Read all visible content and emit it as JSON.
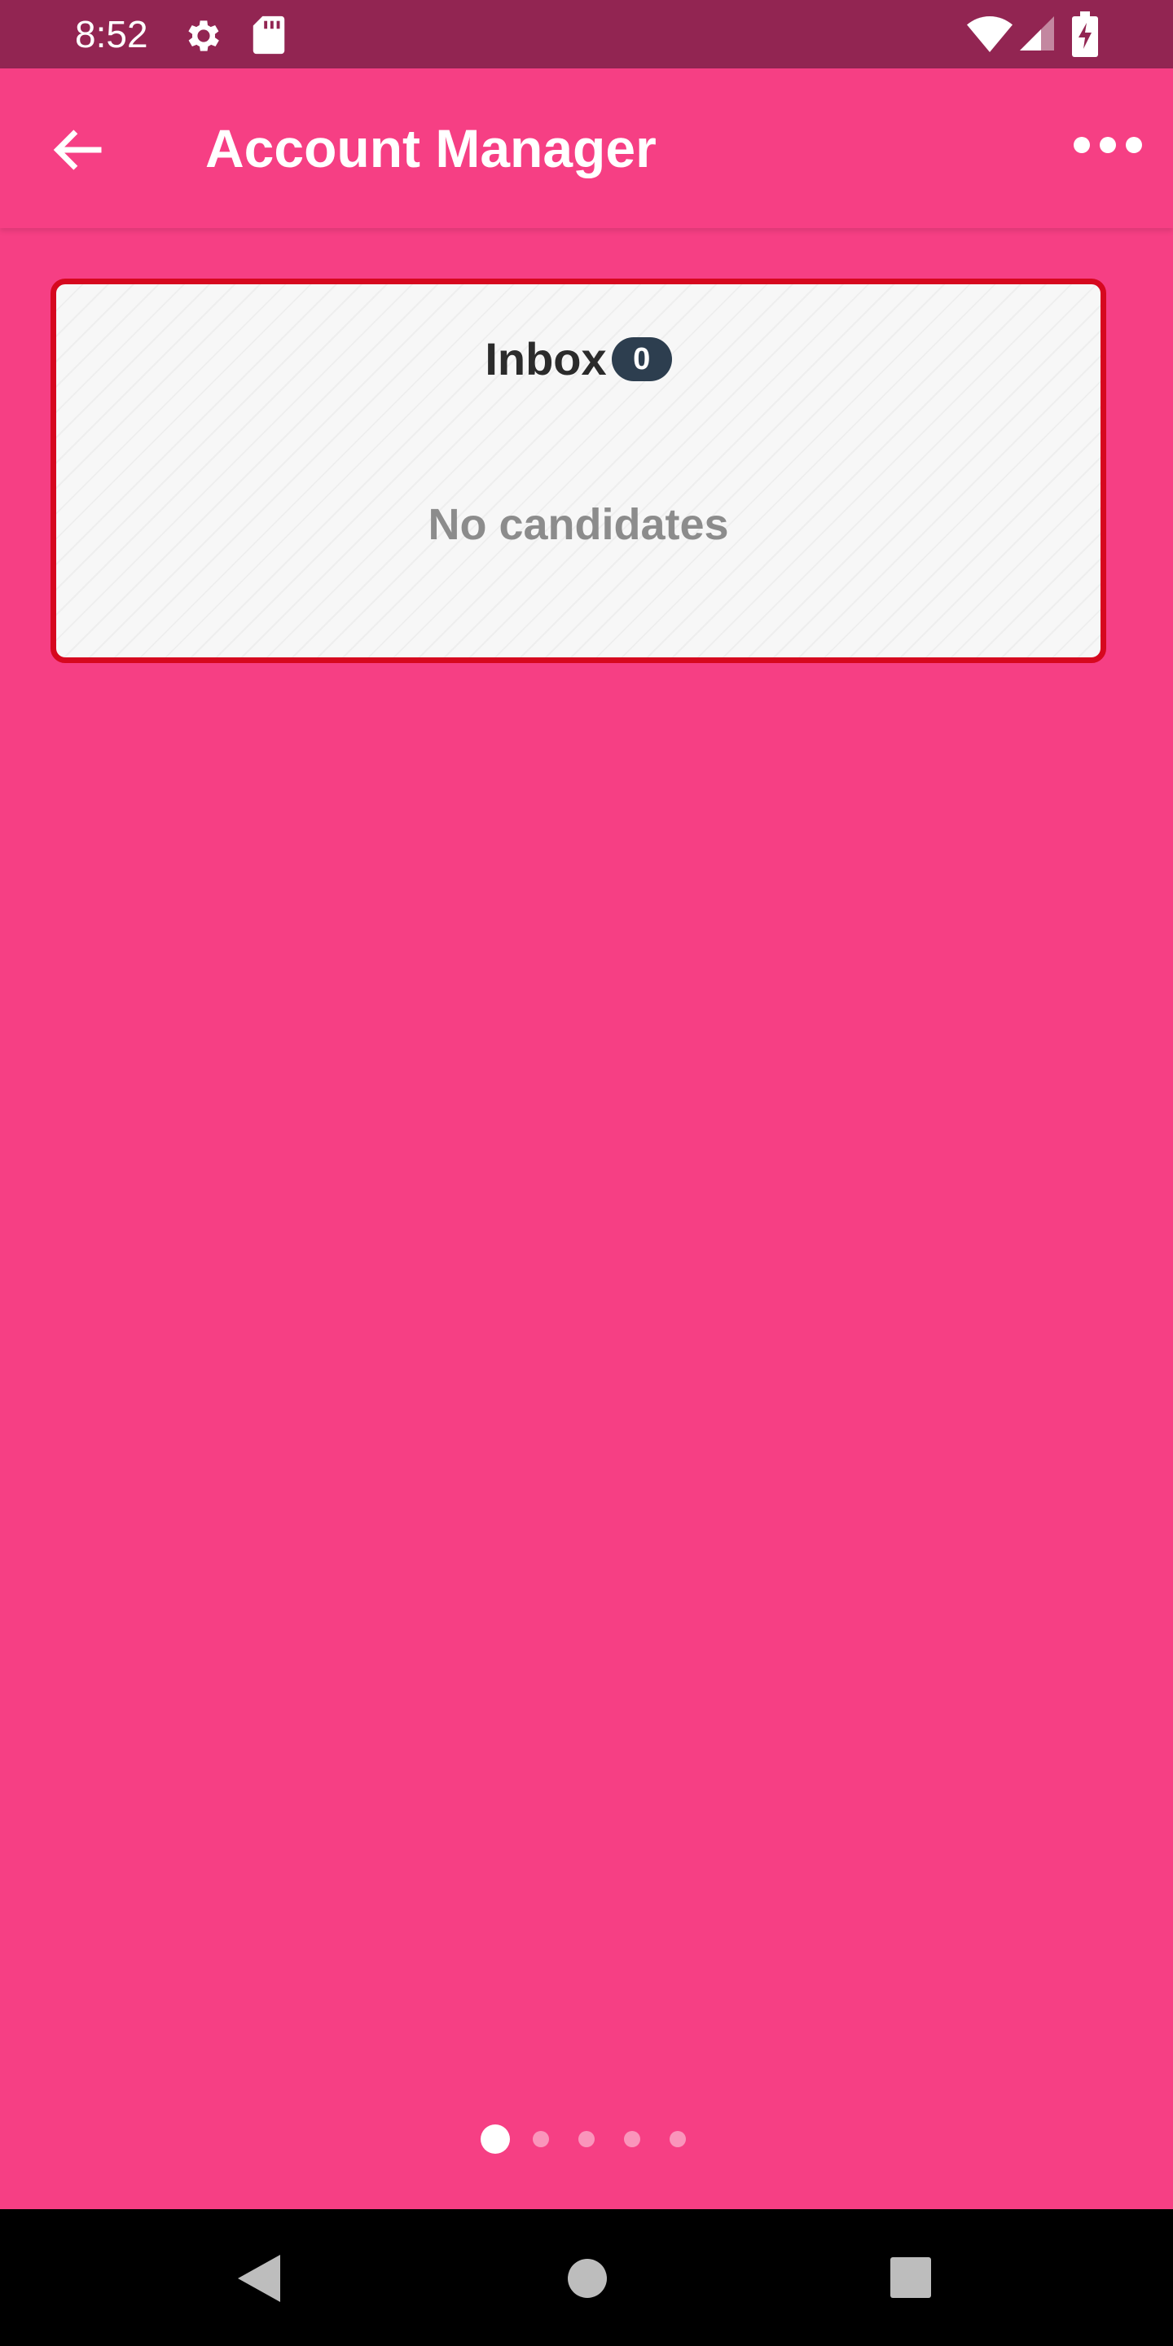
{
  "status_bar": {
    "time": "8:52",
    "icons": [
      "settings-icon",
      "sd-card-icon",
      "wifi-icon",
      "cell-signal-icon",
      "battery-charging-icon"
    ]
  },
  "app_bar": {
    "title": "Account Manager",
    "back_icon": "arrow-back-icon",
    "menu_icon": "more-horizontal-icon"
  },
  "inbox": {
    "title": "Inbox",
    "count": "0",
    "empty_message": "No candidates"
  },
  "pager": {
    "page_count": 5,
    "active_index": 0
  },
  "nav_bar": {
    "icons": [
      "nav-back-icon",
      "nav-home-icon",
      "nav-recents-icon"
    ]
  },
  "colors": {
    "status_bar": "#922552",
    "primary": "#f63f84",
    "card_border": "#d6081f",
    "badge": "#2d3e4f",
    "empty_text": "#8c8c8c"
  }
}
